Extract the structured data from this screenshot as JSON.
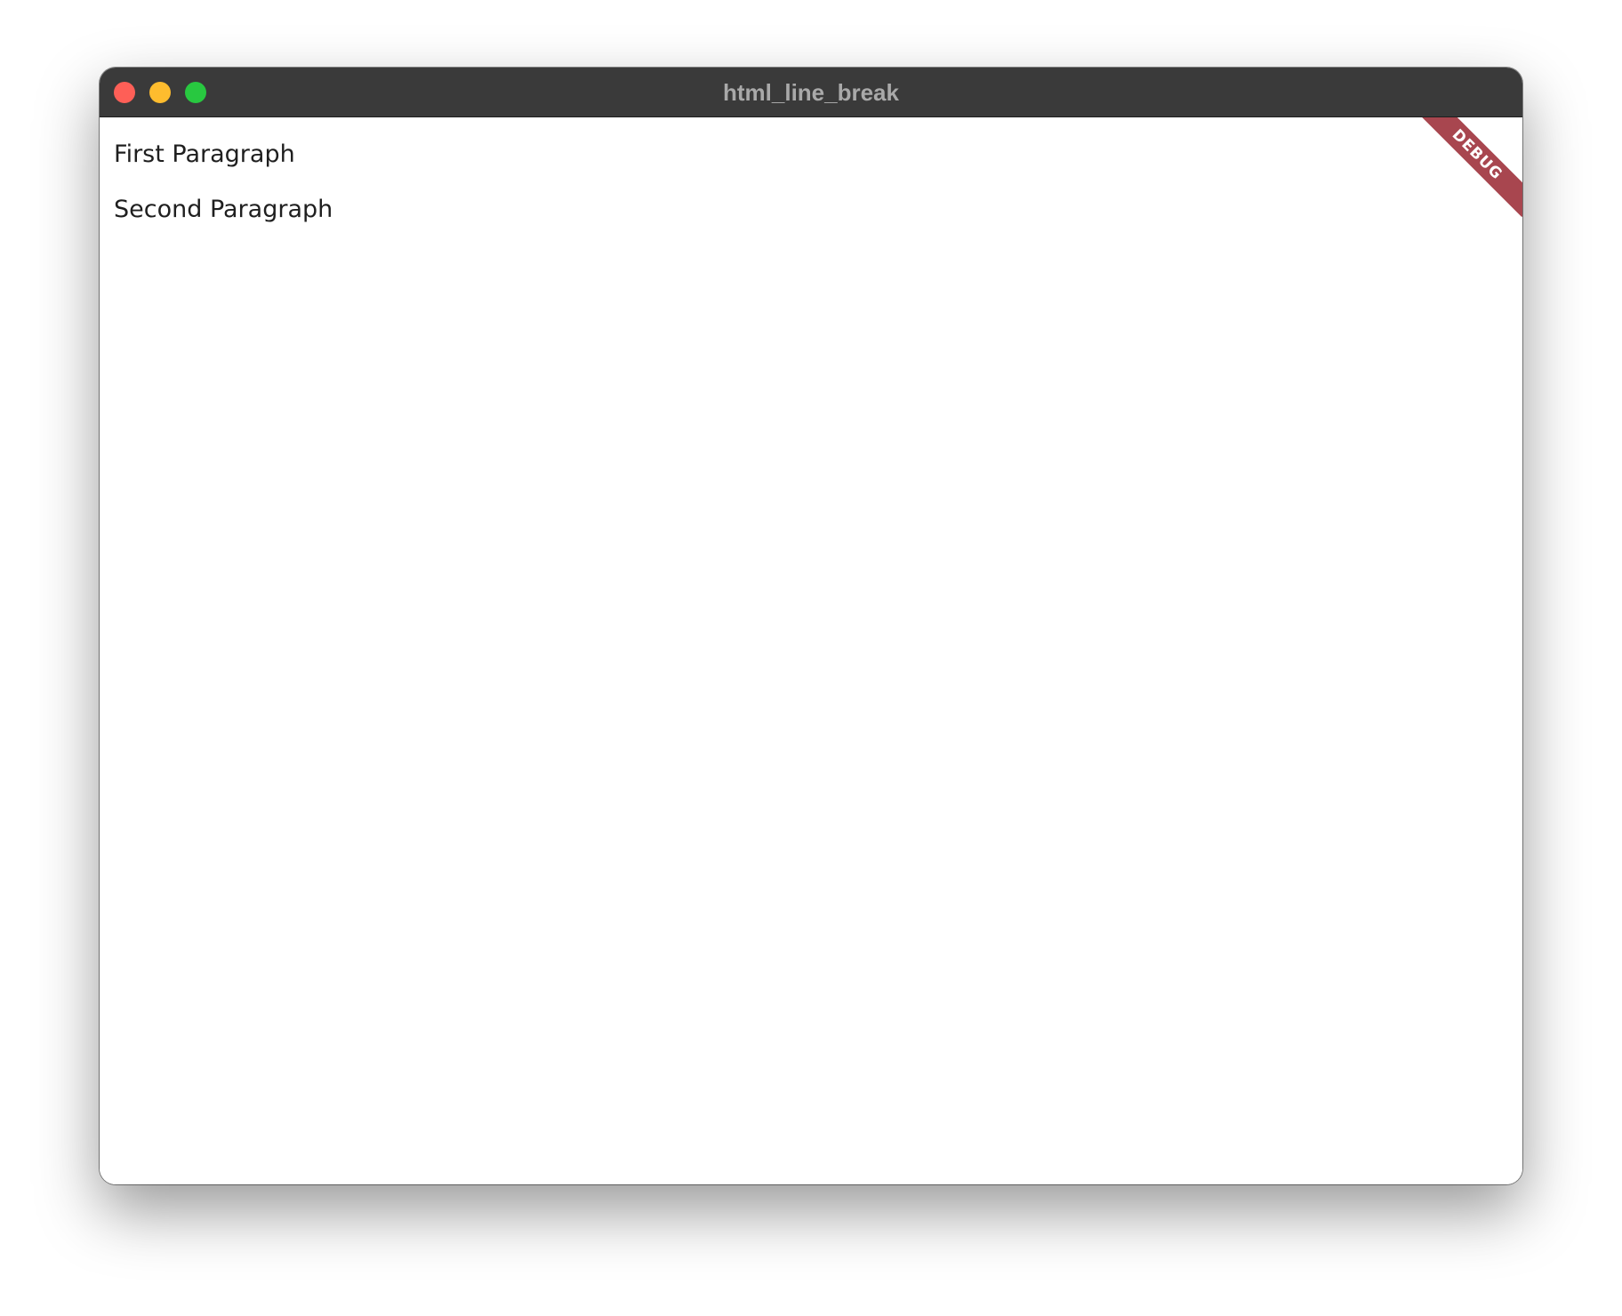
{
  "window": {
    "title": "html_line_break"
  },
  "content": {
    "paragraphs": [
      "First Paragraph",
      "Second Paragraph"
    ]
  },
  "debug_banner": {
    "label": "DEBUG",
    "color": "#a8464f"
  },
  "traffic_lights": {
    "close_color": "#fe5f57",
    "minimize_color": "#febc2e",
    "zoom_color": "#28c840"
  }
}
